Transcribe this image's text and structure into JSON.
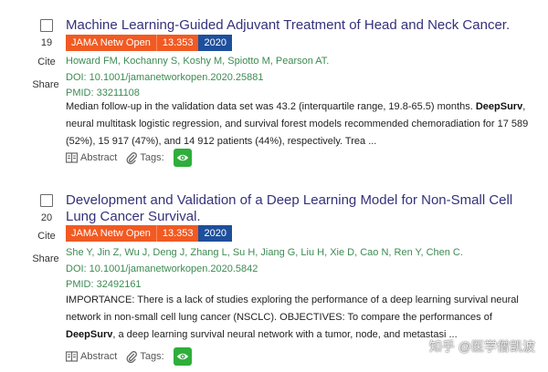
{
  "results": [
    {
      "number": "19",
      "cite_label": "Cite",
      "share_label": "Share",
      "title": "Machine Learning-Guided Adjuvant Treatment of Head and Neck Cancer.",
      "journal": "JAMA Netw Open",
      "impact_factor": "13.353",
      "year": "2020",
      "authors": "Howard FM, Kochanny S, Koshy M, Spiotto M, Pearson AT.",
      "doi": "DOI: 10.1001/jamanetworkopen.2020.25881",
      "pmid": "PMID: 33211108",
      "abstract_pre": "Median follow-up in the validation data set was 43.2 (interquartile range, 19.8-65.5) months. ",
      "abstract_bold": "DeepSurv",
      "abstract_post": ", neural multitask logistic regression, and survival forest models recommended chemoradiation for 17 589 (52%), 15 917 (47%), and 14 912 patients (44%), respectively. Trea ...",
      "abstract_label": "Abstract",
      "tags_label": "Tags:"
    },
    {
      "number": "20",
      "cite_label": "Cite",
      "share_label": "Share",
      "title": "Development and Validation of a Deep Learning Model for Non-Small Cell Lung Cancer Survival.",
      "journal": "JAMA Netw Open",
      "impact_factor": "13.353",
      "year": "2020",
      "authors": "She Y, Jin Z, Wu J, Deng J, Zhang L, Su H, Jiang G, Liu H, Xie D, Cao N, Ren Y, Chen C.",
      "doi": "DOI: 10.1001/jamanetworkopen.2020.5842",
      "pmid": "PMID: 32492161",
      "abstract_pre": "IMPORTANCE: There is a lack of studies exploring the performance of a deep learning survival neural network in non-small cell lung cancer (NSCLC). OBJECTIVES: To compare the performances of ",
      "abstract_bold": "DeepSurv",
      "abstract_post": ", a deep learning survival neural network with a tumor, node, and metastasi ...",
      "abstract_label": "Abstract",
      "tags_label": "Tags:"
    }
  ],
  "watermark": "知乎 @医学僧凯波",
  "colors": {
    "title": "#35317a",
    "journal_badge": "#f15a22",
    "year_badge": "#1e4f9c",
    "meta_green": "#3d8b52",
    "eye_button": "#2fae3c"
  },
  "icons": [
    "checkbox-icon",
    "book-icon",
    "paperclip-icon",
    "eye-icon"
  ]
}
